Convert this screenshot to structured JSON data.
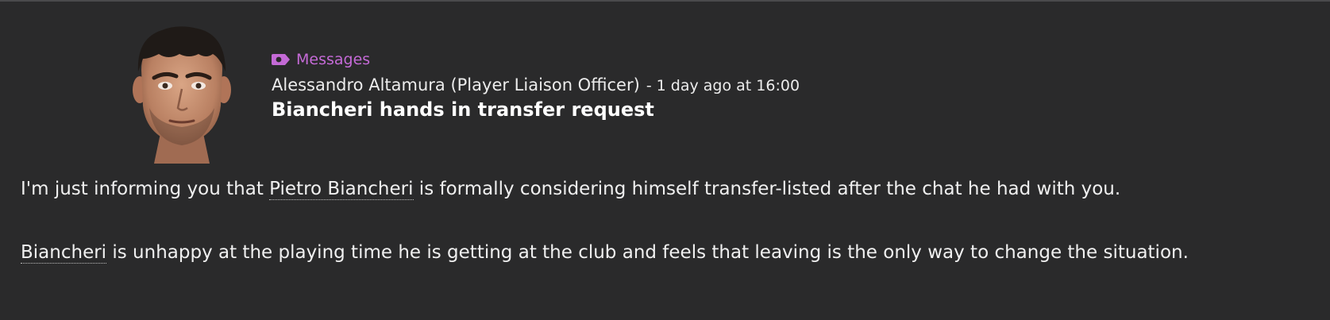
{
  "message": {
    "category_label": "Messages",
    "sender": "Alessandro Altamura (Player Liaison Officer)",
    "separator": "-",
    "timestamp": "1 day ago at 16:00",
    "subject": "Biancheri hands in transfer request",
    "paragraph_1": {
      "before": "I'm just informing you that ",
      "player_link": "Pietro Biancheri",
      "after": " is formally considering himself transfer-listed after the chat he had with you."
    },
    "paragraph_2": {
      "player_link": "Biancheri",
      "after": " is unhappy at the playing time he is getting at the club and feels that leaving is the only way to change the situation."
    }
  },
  "icons": {
    "category": "message-tag-icon",
    "avatar": "player-face-avatar"
  },
  "colors": {
    "background": "#2a2a2b",
    "category_accent": "#c46ad6",
    "text": "#f0f0f0"
  }
}
